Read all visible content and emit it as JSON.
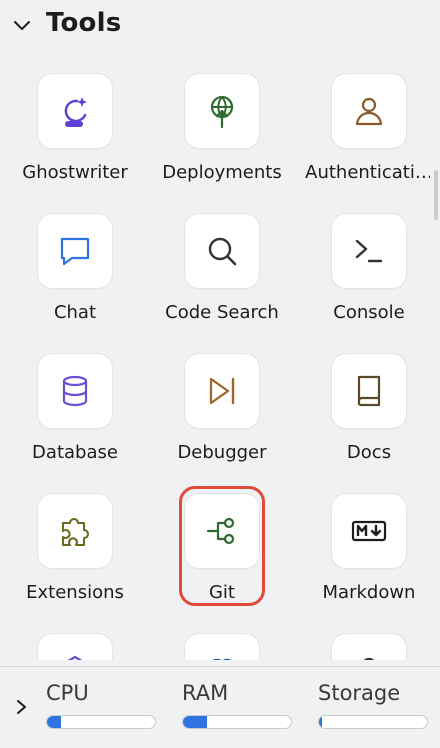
{
  "section": {
    "title": "Tools"
  },
  "tools": [
    {
      "id": "ghostwriter",
      "label": "Ghostwriter",
      "icon": "ghostwriter-icon",
      "color": "#5b3fd6"
    },
    {
      "id": "deployments",
      "label": "Deployments",
      "icon": "deployments-icon",
      "color": "#2f6b2f"
    },
    {
      "id": "authentication",
      "label": "Authenticati…",
      "icon": "user-icon",
      "color": "#8a5a2b"
    },
    {
      "id": "chat",
      "label": "Chat",
      "icon": "chat-icon",
      "color": "#2f73e0"
    },
    {
      "id": "code-search",
      "label": "Code Search",
      "icon": "search-icon",
      "color": "#333333"
    },
    {
      "id": "console",
      "label": "Console",
      "icon": "terminal-icon",
      "color": "#333333"
    },
    {
      "id": "database",
      "label": "Database",
      "icon": "database-icon",
      "color": "#6b4fd0"
    },
    {
      "id": "debugger",
      "label": "Debugger",
      "icon": "debugger-icon",
      "color": "#a0632a"
    },
    {
      "id": "docs",
      "label": "Docs",
      "icon": "book-icon",
      "color": "#5a4a2a"
    },
    {
      "id": "extensions",
      "label": "Extensions",
      "icon": "puzzle-icon",
      "color": "#6b6a1e"
    },
    {
      "id": "git",
      "label": "Git",
      "icon": "git-icon",
      "color": "#2f6b2f",
      "selected": true
    },
    {
      "id": "markdown",
      "label": "Markdown",
      "icon": "markdown-icon",
      "color": "#1c1c1e"
    }
  ],
  "resources": [
    {
      "label": "CPU",
      "level": 0.13
    },
    {
      "label": "RAM",
      "level": 0.22
    },
    {
      "label": "Storage",
      "level": 0.03
    }
  ]
}
